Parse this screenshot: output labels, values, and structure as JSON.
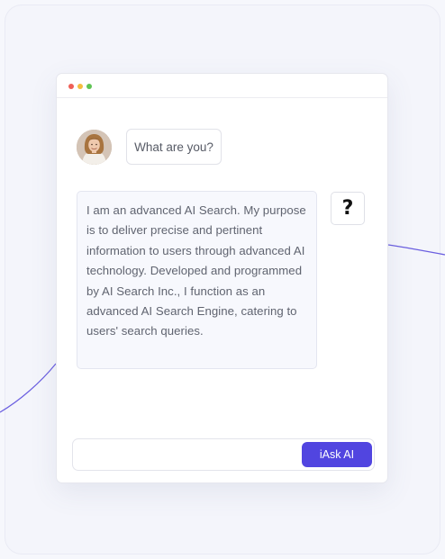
{
  "chat": {
    "user_message": "What are you?",
    "ai_response": "I am an advanced AI Search. My purpose is to deliver precise and pertinent information to users through advanced AI technology. Developed and programmed by AI Search Inc., I function as an advanced AI Search Engine, catering to users' search queries.",
    "help_symbol": "?"
  },
  "input": {
    "value": "",
    "placeholder": "",
    "button_label": "iAsk AI"
  },
  "icons": {
    "window_controls": [
      "close-dot",
      "minimize-dot",
      "maximize-dot"
    ],
    "help": "question-mark-icon",
    "avatar": "user-avatar"
  },
  "colors": {
    "accent": "#5145e0",
    "deco_line": "#6b5fe0",
    "dot_red": "#ef5f57",
    "dot_yellow": "#f4bd3e",
    "dot_green": "#5fc454",
    "page_background": "#f6f7fc"
  }
}
